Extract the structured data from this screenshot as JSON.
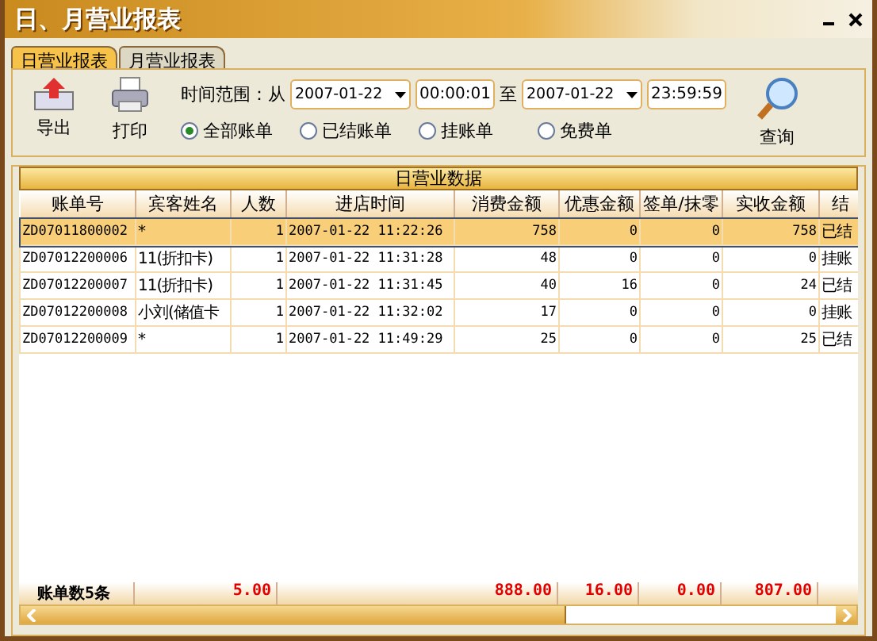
{
  "window": {
    "title": "日、月营业报表"
  },
  "tabs": [
    {
      "label": "日营业报表",
      "selected": true
    },
    {
      "label": "月营业报表",
      "selected": false
    }
  ],
  "toolbar": {
    "export": "导出",
    "print": "打印",
    "query": "查询",
    "range_label": "时间范围：从",
    "to_label": "至",
    "from_date": "2007-01-22",
    "from_time": "00:00:01",
    "to_date": "2007-01-22",
    "to_time": "23:59:59"
  },
  "filters": [
    {
      "label": "全部账单",
      "selected": true
    },
    {
      "label": "已结账单",
      "selected": false
    },
    {
      "label": "挂账单",
      "selected": false
    },
    {
      "label": "免费单",
      "selected": false
    }
  ],
  "table": {
    "title": "日营业数据",
    "columns": [
      "账单号",
      "宾客姓名",
      "人数",
      "进店时间",
      "消费金额",
      "优惠金额",
      "签单/抹零",
      "实收金额",
      "结"
    ],
    "rows": [
      {
        "selected": true,
        "cells": [
          "ZD07011800002",
          "*",
          "1",
          "2007-01-22  11:22:26",
          "758",
          "0",
          "0",
          "758",
          "已结"
        ]
      },
      {
        "selected": false,
        "cells": [
          "ZD07012200006",
          "11(折扣卡)",
          "1",
          "2007-01-22  11:31:28",
          "48",
          "0",
          "0",
          "0",
          "挂账"
        ]
      },
      {
        "selected": false,
        "cells": [
          "ZD07012200007",
          "11(折扣卡)",
          "1",
          "2007-01-22  11:31:45",
          "40",
          "16",
          "0",
          "24",
          "已结"
        ]
      },
      {
        "selected": false,
        "cells": [
          "ZD07012200008",
          "小刘(储值卡",
          "1",
          "2007-01-22  11:32:02",
          "17",
          "0",
          "0",
          "0",
          "挂账"
        ]
      },
      {
        "selected": false,
        "cells": [
          "ZD07012200009",
          "*",
          "1",
          "2007-01-22  11:49:29",
          "25",
          "0",
          "0",
          "25",
          "已结"
        ]
      }
    ],
    "footer": [
      "账单数5条",
      "5.00",
      "888.00",
      "16.00",
      "0.00",
      "807.00"
    ]
  }
}
